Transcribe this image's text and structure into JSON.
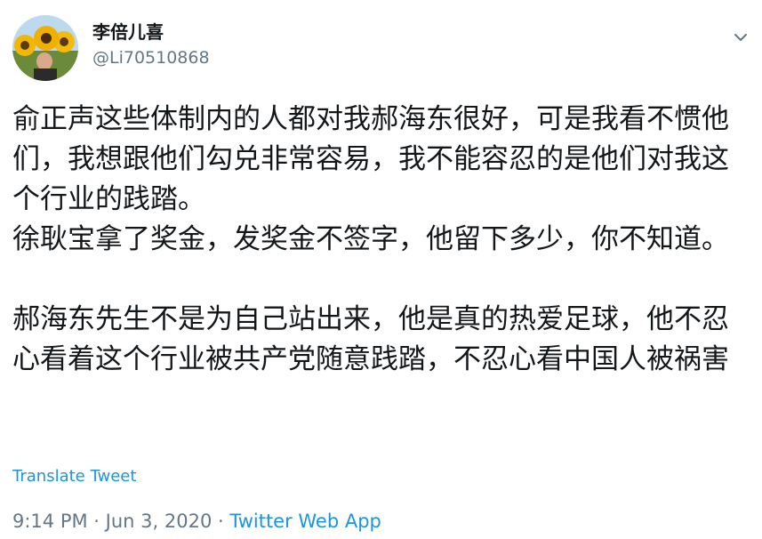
{
  "author": {
    "display_name": "李倍儿喜",
    "handle": "@Li70510868"
  },
  "tweet": {
    "paragraphs": [
      "俞正声这些体制内的人都对我郝海东很好，可是我看不惯他们，我想跟他们勾兑非常容易，我不能容忍的是他们对我这个行业的践踏。",
      "徐耿宝拿了奖金，发奖金不签字，他留下多少，你不知道。",
      "郝海东先生不是为自己站出来，他是真的热爱足球，他不忍心看着这个行业被共产党随意践踏，不忍心看中国人被祸害"
    ],
    "translate_label": "Translate Tweet"
  },
  "meta": {
    "time": "9:14 PM",
    "separator": " · ",
    "date": "Jun 3, 2020",
    "source": "Twitter Web App"
  },
  "icons": {
    "avatar": "sunflower-avatar",
    "caret": "chevron-down-icon"
  },
  "colors": {
    "link": "#1b95e0",
    "muted": "#657786",
    "text": "#14171a"
  }
}
